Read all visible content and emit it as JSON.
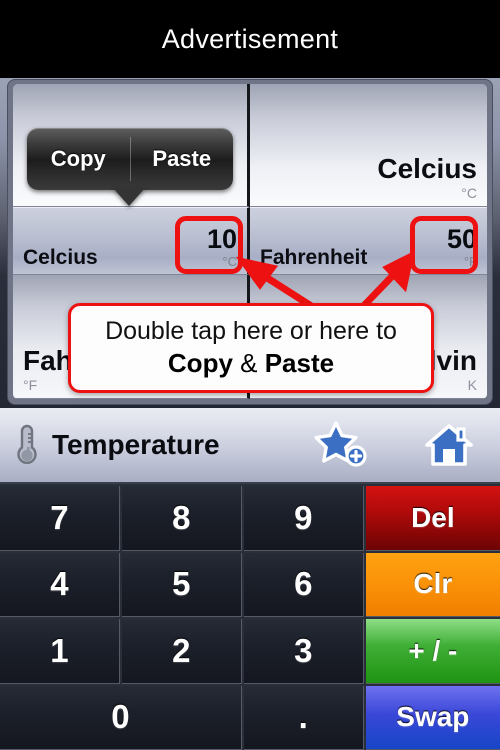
{
  "ad": {
    "label": "Advertisement"
  },
  "display": {
    "rows": [
      {
        "left": {
          "type": "popup"
        },
        "right": {
          "name": "Celcius",
          "unit": "°C"
        }
      },
      {
        "left": {
          "name": "Celcius",
          "value": "10",
          "unit": "°C",
          "highlighted": true
        },
        "right": {
          "name": "Fahrenheit",
          "value": "50",
          "unit": "°F",
          "highlighted": true
        }
      },
      {
        "left": {
          "name": "Fahrenheit",
          "unit": "°F"
        },
        "right": {
          "name": "Kelvin",
          "unit": "K"
        }
      }
    ]
  },
  "copy_paste_popup": {
    "copy_label": "Copy",
    "paste_label": "Paste"
  },
  "callout": {
    "line1": "Double tap here or here to",
    "copy_word": "Copy",
    "amp": " & ",
    "paste_word": "Paste"
  },
  "toolbar": {
    "title": "Temperature",
    "thermometer_icon": "thermometer-icon",
    "favorite_icon": "star-plus-icon",
    "home_icon": "home-icon"
  },
  "keypad": {
    "keys": [
      {
        "label": "7",
        "kind": "num"
      },
      {
        "label": "8",
        "kind": "num"
      },
      {
        "label": "9",
        "kind": "num"
      },
      {
        "label": "Del",
        "kind": "del"
      },
      {
        "label": "4",
        "kind": "num"
      },
      {
        "label": "5",
        "kind": "num"
      },
      {
        "label": "6",
        "kind": "num"
      },
      {
        "label": "Clr",
        "kind": "clr"
      },
      {
        "label": "1",
        "kind": "num"
      },
      {
        "label": "2",
        "kind": "num"
      },
      {
        "label": "3",
        "kind": "num"
      },
      {
        "label": "+ / -",
        "kind": "plusminus"
      },
      {
        "label": "0",
        "kind": "zero"
      },
      {
        "label": ".",
        "kind": "num"
      },
      {
        "label": "Swap",
        "kind": "swap"
      }
    ]
  },
  "colors": {
    "highlight_red": "#ee1111",
    "del_red": "#b00a0a",
    "clr_orange": "#fb9309",
    "plusminus_green": "#3fae36",
    "swap_blue": "#3a47d8",
    "icon_blue": "#3b6fc4"
  }
}
